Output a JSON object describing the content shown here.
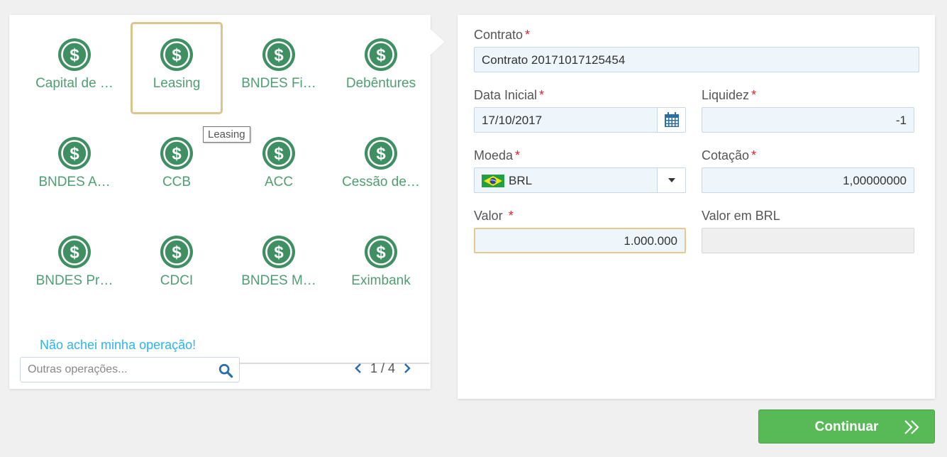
{
  "operations": [
    {
      "label": "Capital de …",
      "selected": false
    },
    {
      "label": "Leasing",
      "selected": true
    },
    {
      "label": "BNDES Fi…",
      "selected": false
    },
    {
      "label": "Debêntures",
      "selected": false
    },
    {
      "label": "BNDES A…",
      "selected": false
    },
    {
      "label": "CCB",
      "selected": false
    },
    {
      "label": "ACC",
      "selected": false
    },
    {
      "label": "Cessão de…",
      "selected": false
    },
    {
      "label": "BNDES Pr…",
      "selected": false
    },
    {
      "label": "CDCI",
      "selected": false
    },
    {
      "label": "BNDES M…",
      "selected": false
    },
    {
      "label": "Eximbank",
      "selected": false
    }
  ],
  "tooltip": "Leasing",
  "not_found_link": "Não achei minha operação!",
  "search": {
    "placeholder": "Outras operações..."
  },
  "pager": {
    "text": "1 / 4"
  },
  "form": {
    "contrato": {
      "label": "Contrato",
      "value": "Contrato 20171017125454"
    },
    "data_inicial": {
      "label": "Data Inicial",
      "value": "17/10/2017"
    },
    "liquidez": {
      "label": "Liquidez",
      "value": "-1"
    },
    "moeda": {
      "label": "Moeda",
      "value": "BRL"
    },
    "cotacao": {
      "label": "Cotação",
      "value": "1,00000000"
    },
    "valor": {
      "label": "Valor",
      "value": "1.000.000"
    },
    "valor_brl": {
      "label": "Valor em BRL",
      "value": ""
    },
    "required_mark": "*"
  },
  "continue_button": "Continuar",
  "colors": {
    "icon_green": "#3f8f63",
    "label_green": "#4f9e72",
    "link_blue": "#2fb4e9",
    "button_green": "#58b957",
    "selected_border": "#d9c68e",
    "required_red": "#dd2233"
  }
}
